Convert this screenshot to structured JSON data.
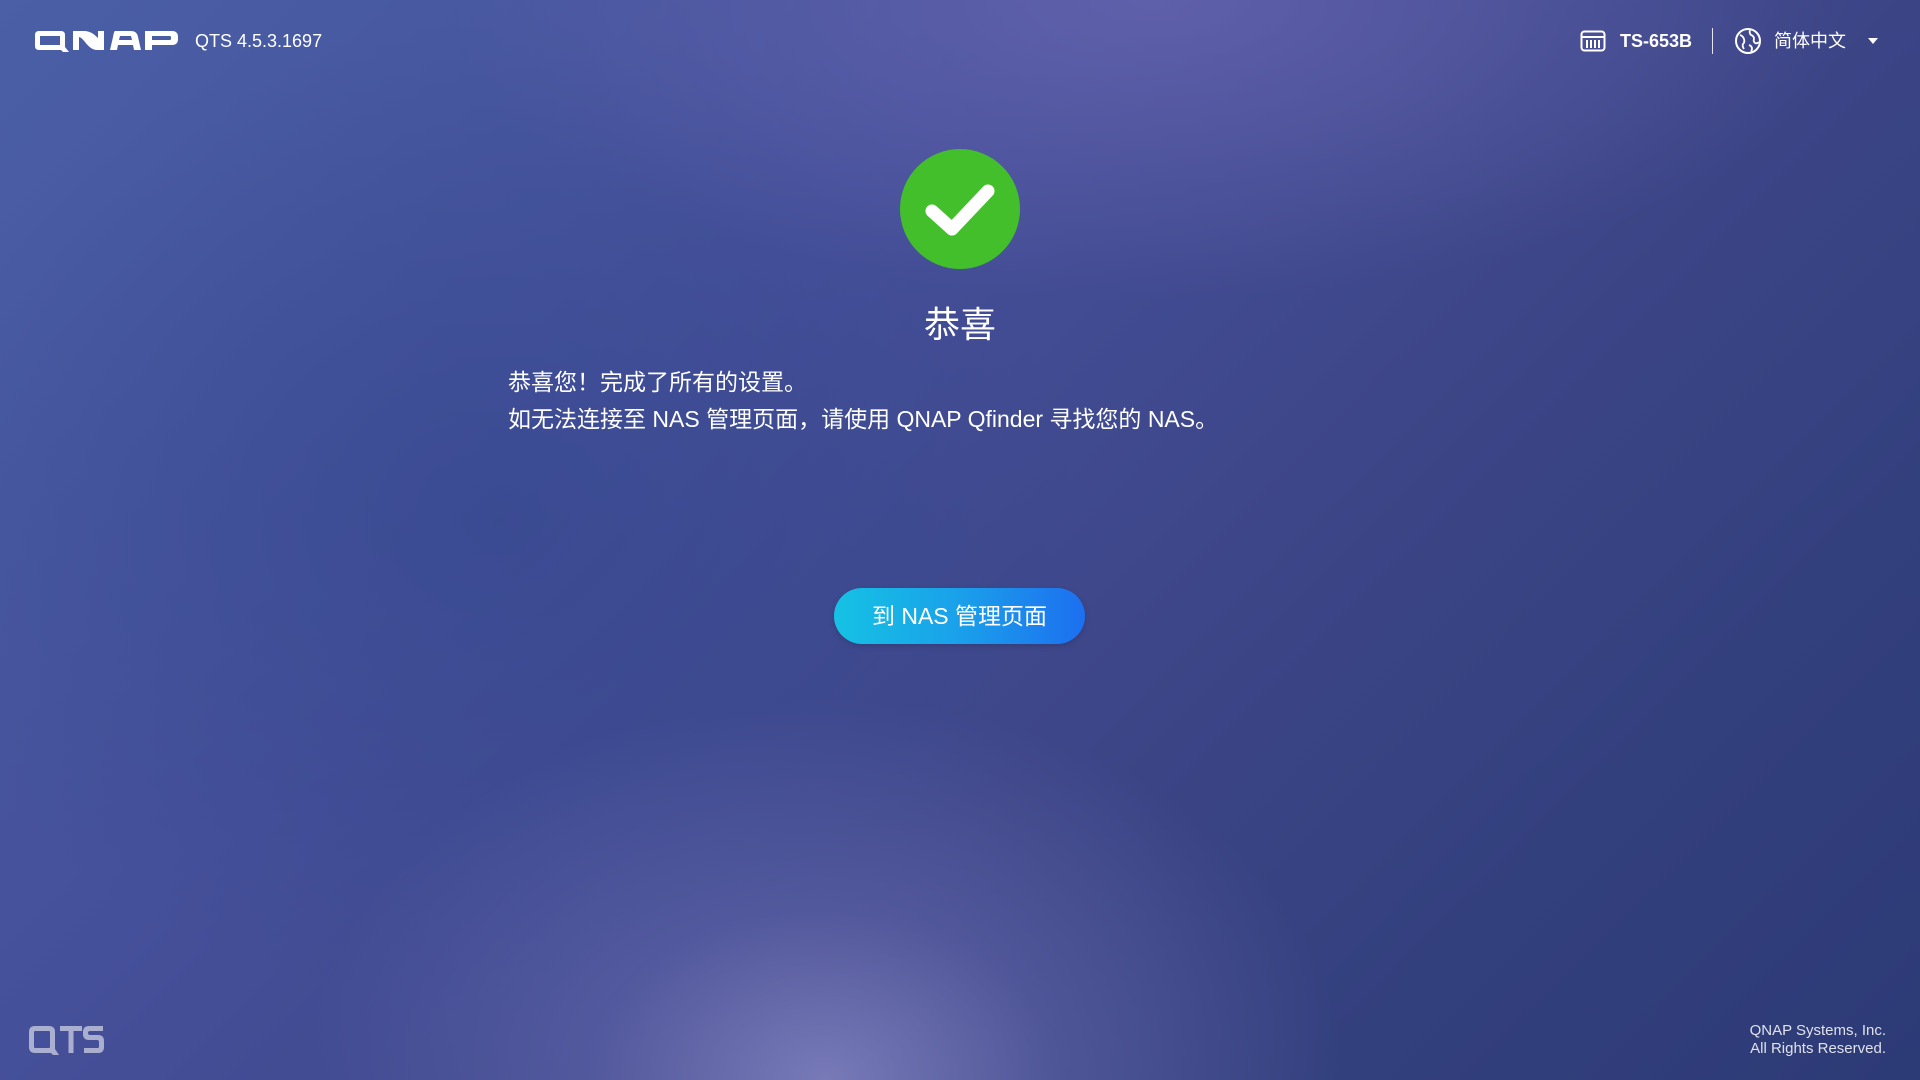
{
  "header": {
    "brand": "QNAP",
    "version": "QTS 4.5.3.1697",
    "model_icon": "nas-device-icon",
    "model": "TS-653B",
    "language_icon": "globe-icon",
    "language": "简体中文"
  },
  "main": {
    "status_icon": "success-check-icon",
    "status_color": "#43bf2b",
    "title": "恭喜",
    "message_line1": "恭喜您！完成了所有的设置。",
    "message_line2": "如无法连接至 NAS 管理页面，请使用 QNAP Qfinder 寻找您的 NAS。",
    "button_label": "到 NAS 管理页面"
  },
  "footer": {
    "product_logo": "QTS",
    "company": "QNAP Systems, Inc.",
    "rights": "All Rights Reserved."
  },
  "colors": {
    "button_start": "#15c2e4",
    "button_end": "#1d6ff0",
    "background": "#3f4c8a"
  }
}
